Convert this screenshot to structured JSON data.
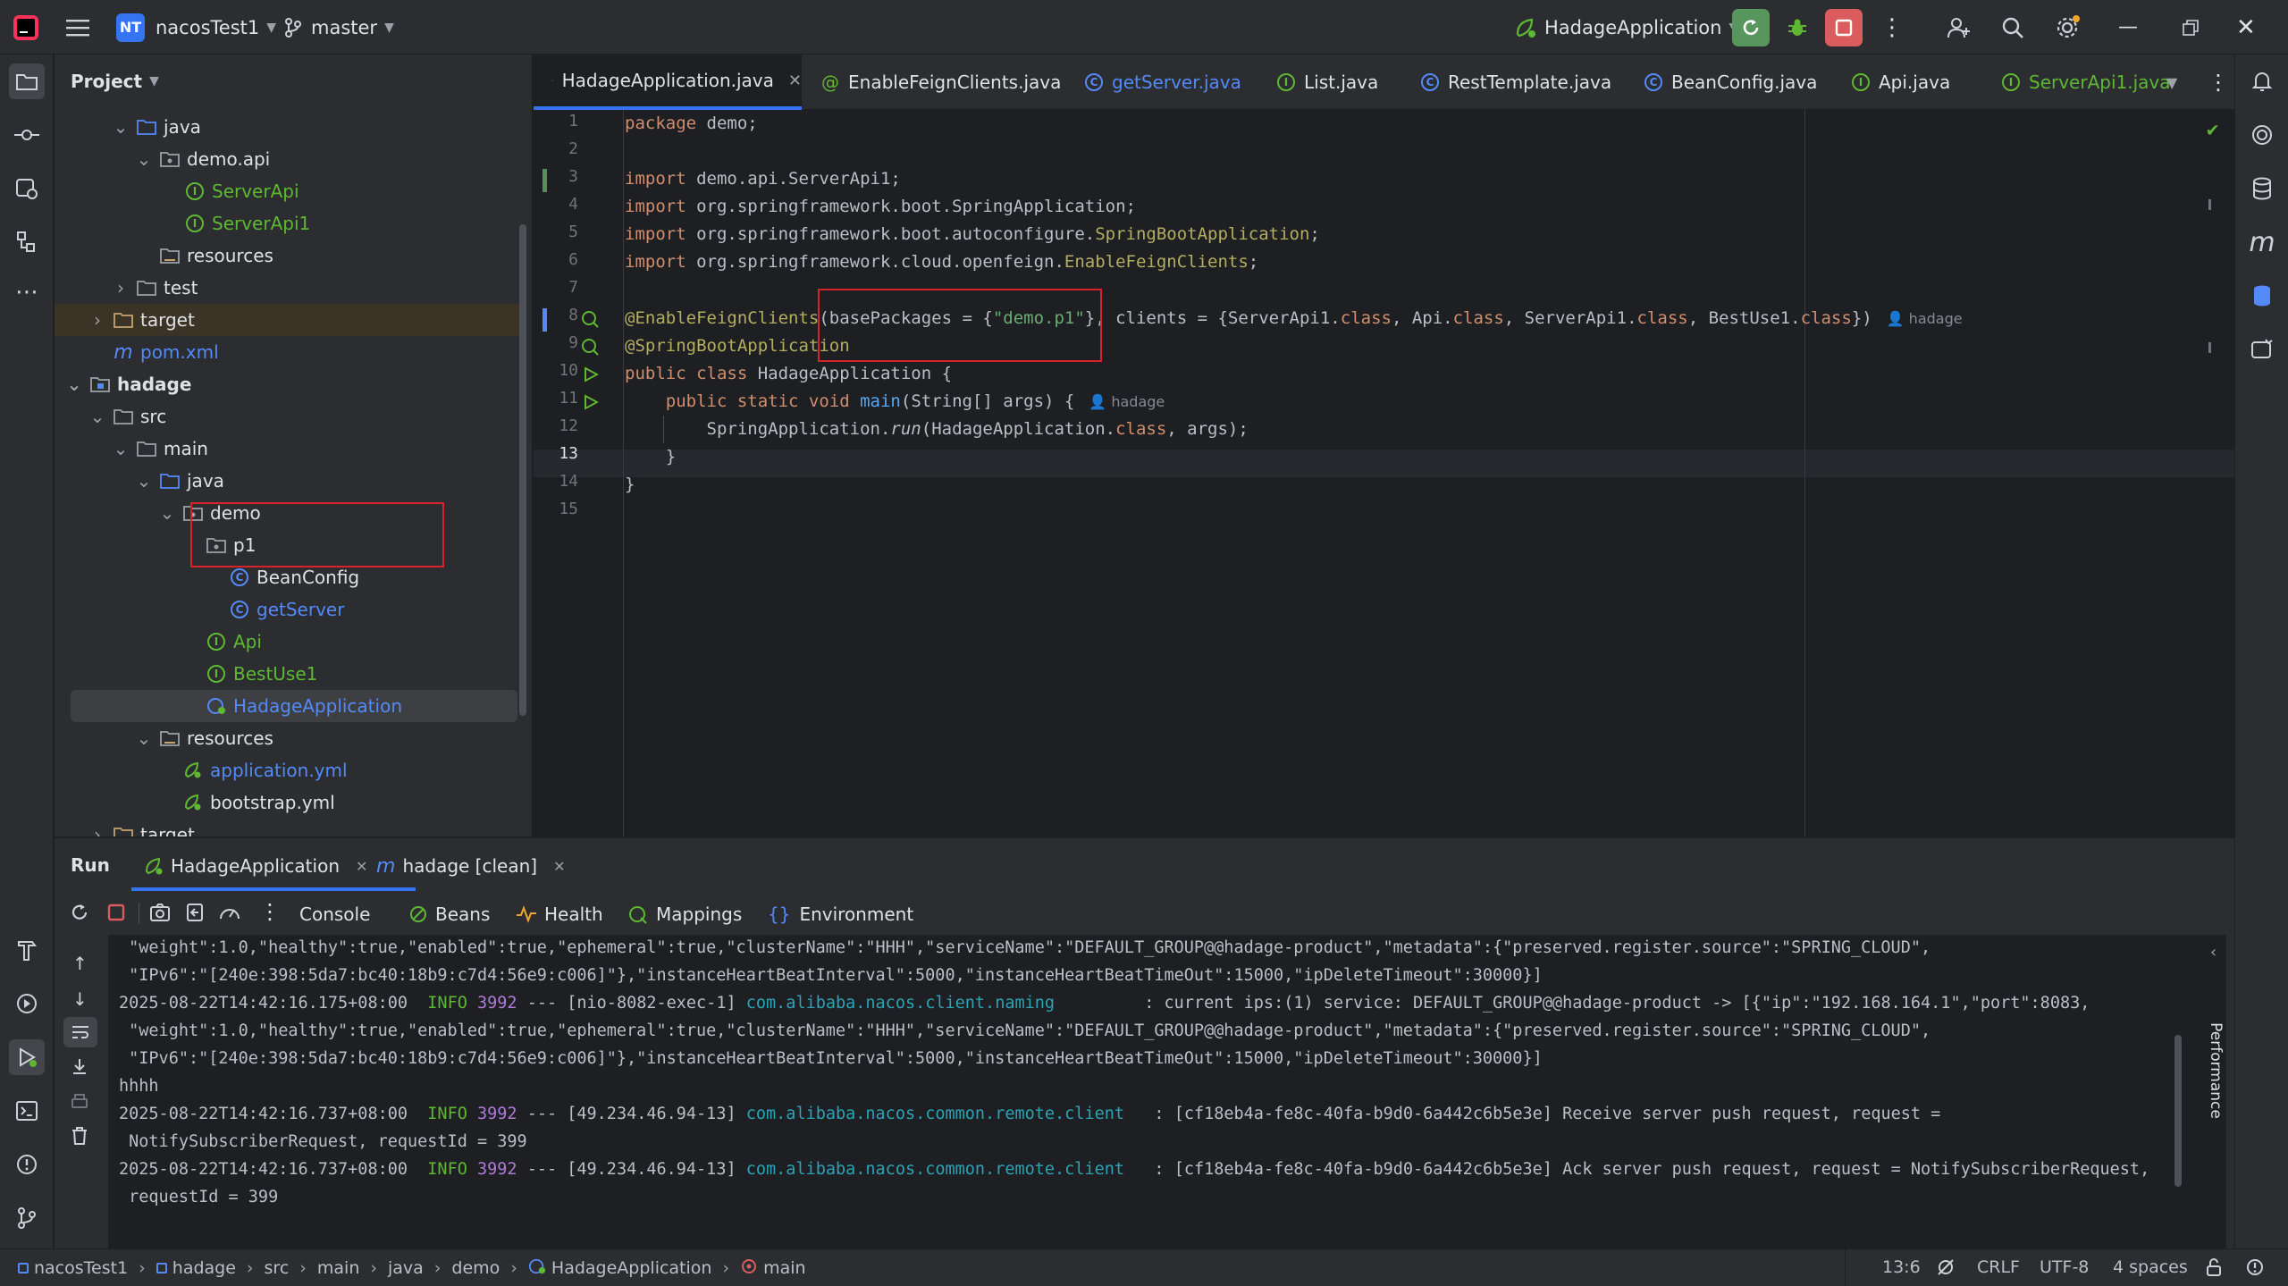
{
  "titlebar": {
    "project_badge": "NT",
    "project_name": "nacosTest1",
    "branch": "master",
    "run_config": "HadageApplication"
  },
  "project_panel": {
    "title": "Project",
    "tree": [
      {
        "label": "java",
        "kind": "folder-src",
        "expanded": true
      },
      {
        "label": "demo.api",
        "kind": "package",
        "expanded": true
      },
      {
        "label": "ServerApi",
        "kind": "interface"
      },
      {
        "label": "ServerApi1",
        "kind": "interface"
      },
      {
        "label": "resources",
        "kind": "folder-res"
      },
      {
        "label": "test",
        "kind": "folder",
        "expanded": false
      },
      {
        "label": "target",
        "kind": "folder-target",
        "expanded": false
      },
      {
        "label": "pom.xml",
        "kind": "maven"
      },
      {
        "label": "hadage",
        "kind": "module",
        "expanded": true
      },
      {
        "label": "src",
        "kind": "folder",
        "expanded": true
      },
      {
        "label": "main",
        "kind": "folder",
        "expanded": true
      },
      {
        "label": "java",
        "kind": "folder-src",
        "expanded": true
      },
      {
        "label": "demo",
        "kind": "package",
        "expanded": true
      },
      {
        "label": "p1",
        "kind": "package",
        "expanded": true
      },
      {
        "label": "BeanConfig",
        "kind": "class"
      },
      {
        "label": "getServer",
        "kind": "class"
      },
      {
        "label": "Api",
        "kind": "interface"
      },
      {
        "label": "BestUse1",
        "kind": "interface"
      },
      {
        "label": "HadageApplication",
        "kind": "springboot"
      },
      {
        "label": "resources",
        "kind": "folder-res",
        "expanded": true
      },
      {
        "label": "application.yml",
        "kind": "yml"
      },
      {
        "label": "bootstrap.yml",
        "kind": "yml"
      },
      {
        "label": "target",
        "kind": "folder-target",
        "expanded": false
      }
    ]
  },
  "editor_tabs": [
    {
      "label": "HadageApplication.java",
      "active": true
    },
    {
      "label": "EnableFeignClients.java"
    },
    {
      "label": "getServer.java"
    },
    {
      "label": "List.java"
    },
    {
      "label": "RestTemplate.java"
    },
    {
      "label": "BeanConfig.java"
    },
    {
      "label": "Api.java"
    },
    {
      "label": "ServerApi1.java"
    }
  ],
  "editor": {
    "line_numbers": [
      "1",
      "2",
      "3",
      "4",
      "5",
      "6",
      "7",
      "8",
      "9",
      "10",
      "11",
      "12",
      "13",
      "14",
      "15"
    ],
    "code": {
      "l1_kw": "package",
      "l1_rest": " demo;",
      "l3_kw": "import",
      "l3_rest": " demo.api.ServerApi1;",
      "l4_kw": "import",
      "l4_rest": " org.springframework.boot.SpringApplication;",
      "l5_kw": "import",
      "l5_rest": " org.springframework.boot.autoconfigure.",
      "l5_ann": "SpringBootApplication",
      "l5_end": ";",
      "l6_kw": "import",
      "l6_rest": " org.springframework.cloud.openfeign.",
      "l6_ann": "EnableFeignClients",
      "l6_end": ";",
      "l8_ann": "@EnableFeignClients",
      "l8_a": "(basePackages = {",
      "l8_str": "\"demo.p1\"",
      "l8_b": "}, clients = {ServerApi1.",
      "l8_k1": "class",
      "l8_c": ", Api.",
      "l8_k2": "class",
      "l8_d": ", ServerApi1.",
      "l8_k3": "class",
      "l8_e": ", BestUse1.",
      "l8_k4": "class",
      "l8_f": "})",
      "l8_hint": "hadage",
      "l9_ann": "@SpringBootApplication",
      "l10_kw": "public class",
      "l10_rest": " HadageApplication {",
      "l11_kw": "public static void",
      "l11_fn": " main",
      "l11_rest": "(String[] args) {",
      "l11_hint": "hadage",
      "l12_a": "SpringApplication.",
      "l12_it": "run",
      "l12_b": "(HadageApplication.",
      "l12_kw": "class",
      "l12_c": ", args);",
      "l13": "}",
      "l14": "}"
    }
  },
  "run_panel": {
    "title": "Run",
    "tabs": [
      {
        "label": "HadageApplication"
      },
      {
        "label": "hadage [clean]"
      }
    ],
    "subtabs": [
      "Console",
      "Beans",
      "Health",
      "Mappings",
      "Environment"
    ],
    "side_label": "Performance",
    "console": [
      {
        "plain": " \"weight\":1.0,\"healthy\":true,\"enabled\":true,\"ephemeral\":true,\"clusterName\":\"HHH\",\"serviceName\":\"DEFAULT_GROUP@@hadage-product\",\"metadata\":{\"preserved.register.source\":\"SPRING_CLOUD\","
      },
      {
        "plain": " \"IPv6\":\"[240e:398:5da7:bc40:18b9:c7d4:56e9:c006]\"},\"instanceHeartBeatInterval\":5000,\"instanceHeartBeatTimeOut\":15000,\"ipDeleteTimeout\":30000}]"
      },
      {
        "ts": "2025-08-22T14:42:16.175+08:00",
        "level": "INFO",
        "pid": "3992",
        "thread": " --- [nio-8082-exec-1] ",
        "logger": "com.alibaba.nacos.client.naming",
        "msg": "         : current ips:(1) service: DEFAULT_GROUP@@hadage-product -> [{\"ip\":\"192.168.164.1\",\"port\":8083,"
      },
      {
        "plain": " \"weight\":1.0,\"healthy\":true,\"enabled\":true,\"ephemeral\":true,\"clusterName\":\"HHH\",\"serviceName\":\"DEFAULT_GROUP@@hadage-product\",\"metadata\":{\"preserved.register.source\":\"SPRING_CLOUD\","
      },
      {
        "plain": " \"IPv6\":\"[240e:398:5da7:bc40:18b9:c7d4:56e9:c006]\"},\"instanceHeartBeatInterval\":5000,\"instanceHeartBeatTimeOut\":15000,\"ipDeleteTimeout\":30000}]"
      },
      {
        "plain": "hhhh"
      },
      {
        "ts": "2025-08-22T14:42:16.737+08:00",
        "level": "INFO",
        "pid": "3992",
        "thread": " --- [49.234.46.94-13] ",
        "logger": "com.alibaba.nacos.common.remote.client",
        "msg": "   : [cf18eb4a-fe8c-40fa-b9d0-6a442c6b5e3e] Receive server push request, request ="
      },
      {
        "plain": " NotifySubscriberRequest, requestId = 399"
      },
      {
        "ts": "2025-08-22T14:42:16.737+08:00",
        "level": "INFO",
        "pid": "3992",
        "thread": " --- [49.234.46.94-13] ",
        "logger": "com.alibaba.nacos.common.remote.client",
        "msg": "   : [cf18eb4a-fe8c-40fa-b9d0-6a442c6b5e3e] Ack server push request, request = NotifySubscriberRequest,"
      },
      {
        "plain": " requestId = 399"
      }
    ]
  },
  "statusbar": {
    "breadcrumb": [
      "nacosTest1",
      "hadage",
      "src",
      "main",
      "java",
      "demo",
      "HadageApplication",
      "main"
    ],
    "position": "13:6",
    "line_sep": "CRLF",
    "encoding": "UTF-8",
    "indent": "4 spaces"
  }
}
